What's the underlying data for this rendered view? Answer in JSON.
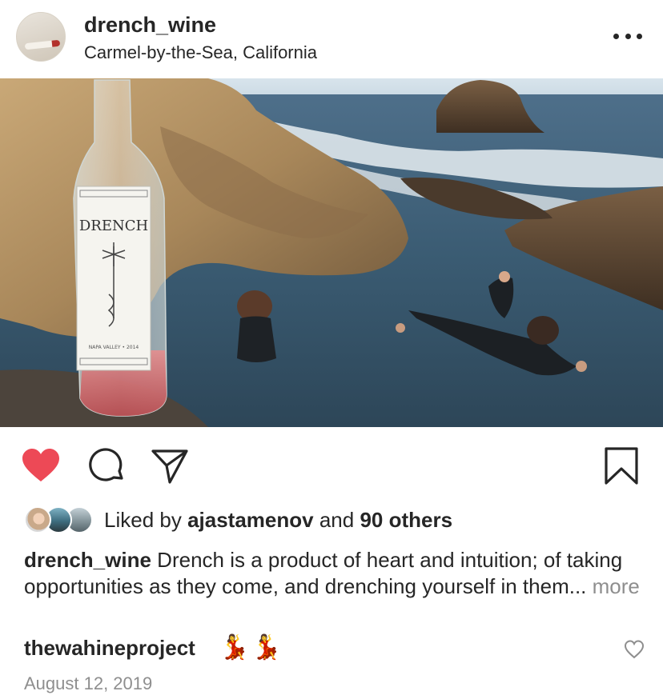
{
  "post": {
    "username": "drench_wine",
    "location": "Carmel-by-the-Sea, California",
    "photo": {
      "bottle_label_brand": "DRENCH",
      "bottle_label_subtext": "NAPA VALLEY • 2014"
    },
    "likes": {
      "prefix": "Liked by",
      "liker": "ajastamenov",
      "connector": "and",
      "others": "90 others"
    },
    "caption": {
      "username": "drench_wine",
      "text": "Drench is a product of heart and intuition; of taking opportunities as they come, and drenching yourself in them...",
      "more_label": "more"
    },
    "comment": {
      "username": "thewahineproject",
      "emojis": [
        "💃",
        "💃"
      ]
    },
    "date": "August 12, 2019"
  },
  "colors": {
    "like_red": "#ed4956",
    "text": "#262626",
    "muted": "#8e8e8e"
  },
  "icons": [
    "more-options-icon",
    "heart-icon",
    "comment-icon",
    "share-icon",
    "bookmark-icon",
    "heart-outline-icon"
  ]
}
